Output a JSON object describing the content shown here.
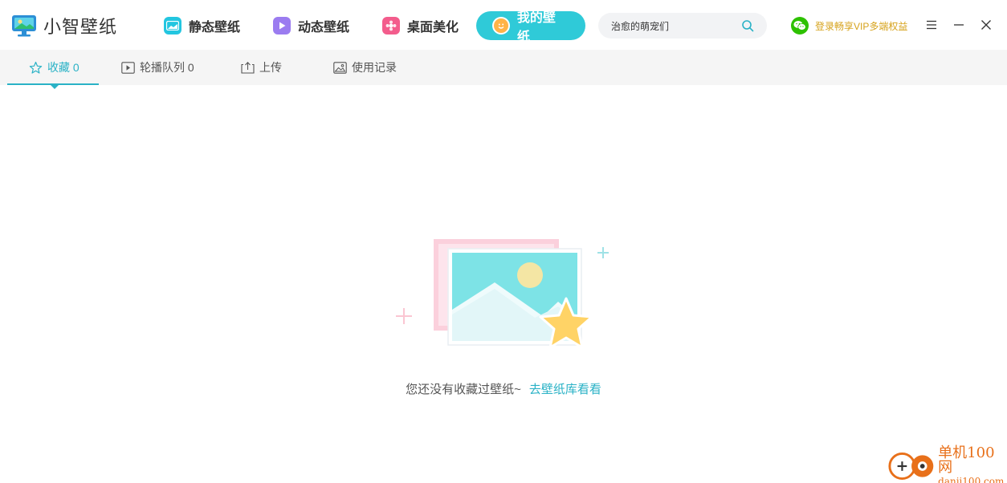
{
  "app": {
    "name": "小智壁纸",
    "icon": "monitor-logo-icon"
  },
  "nav": {
    "items": [
      {
        "label": "静态壁纸",
        "icon": "landscape-icon",
        "color": "#23c6e0"
      },
      {
        "label": "动态壁纸",
        "icon": "play-icon",
        "color": "#9b7cf0"
      },
      {
        "label": "桌面美化",
        "icon": "flower-icon",
        "color": "#f35c8c"
      },
      {
        "label": "我的壁纸",
        "icon": "smiley-icon",
        "color": "#2fcad8",
        "active": true
      }
    ]
  },
  "search": {
    "value": "治愈的萌宠们",
    "icon": "search-icon"
  },
  "vip": {
    "label": "登录畅享VIP多端权益",
    "icon": "wechat-icon",
    "color": "#d6a21a"
  },
  "window_controls": {
    "menu": "menu-icon",
    "minimize": "minimize-icon",
    "close": "close-icon"
  },
  "tabs": [
    {
      "label": "收藏 0",
      "icon": "star-outline-icon",
      "active": true
    },
    {
      "label": "轮播队列 0",
      "icon": "play-square-icon"
    },
    {
      "label": "上传",
      "icon": "upload-icon"
    },
    {
      "label": "使用记录",
      "icon": "image-history-icon"
    }
  ],
  "empty_state": {
    "message": "您还没有收藏过壁纸~",
    "link": "去壁纸库看看",
    "illustration": "empty-favorites-illustration"
  },
  "watermark": {
    "name_cn": "单机100网",
    "name_en": "danji100.com"
  },
  "colors": {
    "accent": "#2ab2c6",
    "active_nav": "#2fcad8",
    "vip": "#d6a21a",
    "watermark": "#e8701a"
  }
}
